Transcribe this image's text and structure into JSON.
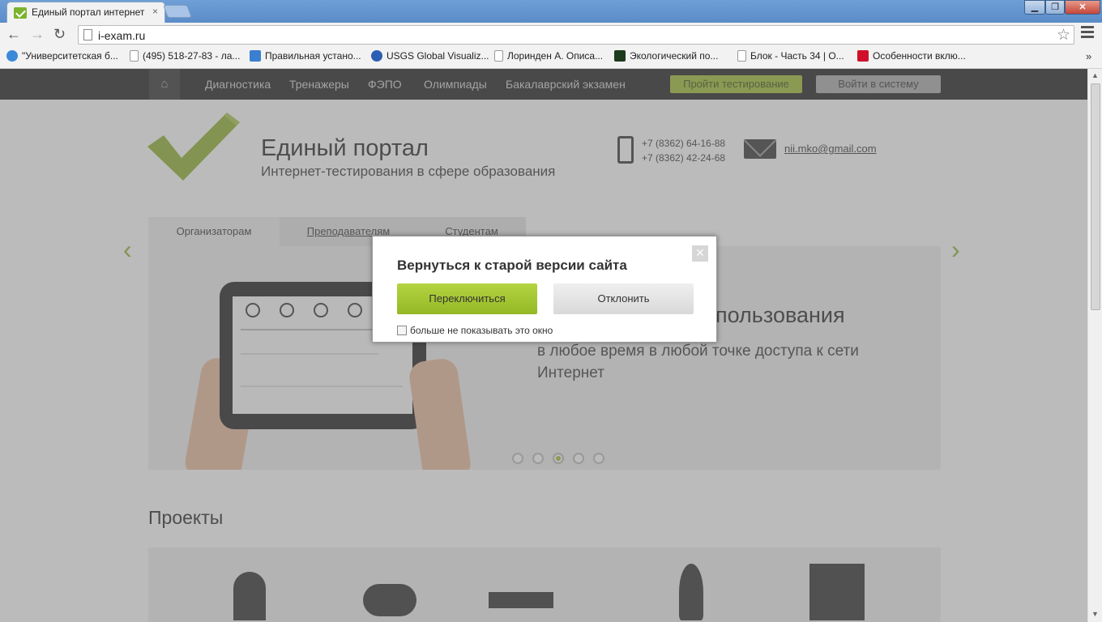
{
  "browser": {
    "tab_title": "Единый портал интернет",
    "tab_close": "×",
    "url": "i-exam.ru",
    "window_controls": {
      "minimize": "▁",
      "maximize": "❐",
      "close": "✕"
    },
    "bookmarks": [
      "\"Университетская б...",
      "(495) 518-27-83 - ла...",
      "Правильная устано...",
      "USGS Global Visualiz...",
      "Лоринден А. Описа...",
      "Экологический по...",
      "Блок - Часть 34 | О...",
      "Особенности вклю..."
    ],
    "bookmarks_more": "»"
  },
  "nav": {
    "home_icon": "⌂",
    "links": [
      "Диагностика",
      "Тренажеры",
      "ФЭПО",
      "Олимпиады",
      "Бакалаврский экзамен"
    ],
    "test_button": "Пройти тестирование",
    "login_button": "Войти в систему"
  },
  "header": {
    "title": "Единый портал",
    "subtitle": "Интернет-тестирования в сфере образования",
    "phones": [
      "+7 (8362) 64-16-88",
      "+7 (8362) 42-24-68"
    ],
    "email": "nii.mko@gmail.com"
  },
  "tabs": [
    "Организаторам",
    "Преподавателям",
    "Студентам"
  ],
  "slider": {
    "heading_partial": "пользования",
    "text": "в любое время в любой точке доступа к сети Интернет",
    "prev_arrow": "‹",
    "next_arrow": "›",
    "dots": 5,
    "active_dot": 2
  },
  "projects": {
    "title": "Проекты"
  },
  "modal": {
    "title": "Вернуться к старой версии сайта",
    "switch_button": "Переключиться",
    "decline_button": "Отклонить",
    "checkbox_label": "больше не показывать это окно",
    "close": "×"
  },
  "colors": {
    "accent": "#9cbd2e",
    "nav_bg": "#1b1b1b",
    "overlay": "rgba(120,120,120,0.5)"
  }
}
